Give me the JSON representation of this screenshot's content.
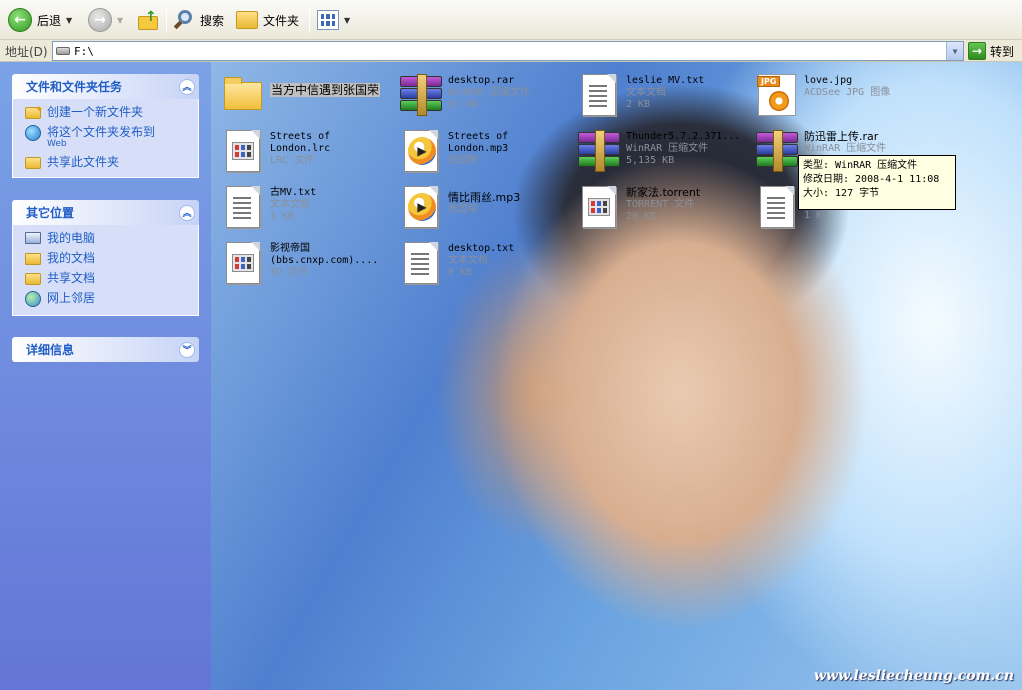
{
  "toolbar": {
    "back_label": "后退",
    "search_label": "搜索",
    "folders_label": "文件夹"
  },
  "address": {
    "label": "地址(D)",
    "path": "F:\\",
    "go_label": "转到"
  },
  "taskpane": {
    "file_tasks": {
      "title": "文件和文件夹任务",
      "items": [
        {
          "label": "创建一个新文件夹",
          "sub": ""
        },
        {
          "label": "将这个文件夹发布到",
          "sub": "Web"
        },
        {
          "label": "共享此文件夹",
          "sub": ""
        }
      ]
    },
    "other_places": {
      "title": "其它位置",
      "items": [
        "我的电脑",
        "我的文档",
        "共享文档",
        "网上邻居"
      ]
    },
    "details": {
      "title": "详细信息"
    }
  },
  "files": [
    {
      "name": "当方中信遇到张国荣",
      "type": "",
      "size": "",
      "icon": "folder-icon"
    },
    {
      "name": "desktop.rar",
      "type": "WinRAR 压缩文件",
      "size": "93 KB",
      "icon": "rar-icon"
    },
    {
      "name": "leslie MV.txt",
      "type": "文本文档",
      "size": "2 KB",
      "icon": "text-file-icon"
    },
    {
      "name": "love.jpg",
      "type": "ACDSee JPG 图像",
      "size": "",
      "icon": "jpg-icon"
    },
    {
      "name": "Streets of\nLondon.lrc",
      "type": "LRC 文件",
      "size": "",
      "icon": "generic-file-icon"
    },
    {
      "name": "Streets of\nLondon.mp3",
      "type": "张国荣",
      "size": "",
      "icon": "media-file-icon"
    },
    {
      "name": "Thunder5.7.2.371...",
      "type": "WinRAR 压缩文件",
      "size": "5,135 KB",
      "icon": "rar-icon"
    },
    {
      "name": "防迅雷上传.rar",
      "type": "WinRAR 压缩文件",
      "size": "",
      "icon": "rar-icon"
    },
    {
      "name": "古MV.txt",
      "type": "文本文档",
      "size": "1 KB",
      "icon": "text-file-icon"
    },
    {
      "name": "情比雨丝.mp3",
      "type": "张国荣",
      "size": "",
      "icon": "media-file-icon"
    },
    {
      "name": "新家法.torrent",
      "type": "TORRENT 文件",
      "size": "20 KB",
      "icon": "generic-file-icon"
    },
    {
      "name": "",
      "type": "",
      "size": "1 KB",
      "icon": "text-file-icon"
    },
    {
      "name": "影视帝国\n(bbs.cnxp.com)....",
      "type": "TD 文件",
      "size": "",
      "icon": "generic-file-icon"
    },
    {
      "name": "desktop.txt",
      "type": "文本文档",
      "size": "0 KB",
      "icon": "text-file-icon"
    }
  ],
  "tooltip": {
    "line1": "类型: WinRAR 压缩文件",
    "line2": "修改日期: 2008-4-1 11:08",
    "line3": "大小: 127 字节"
  },
  "watermark": "www.lesliecheung.com.cn"
}
